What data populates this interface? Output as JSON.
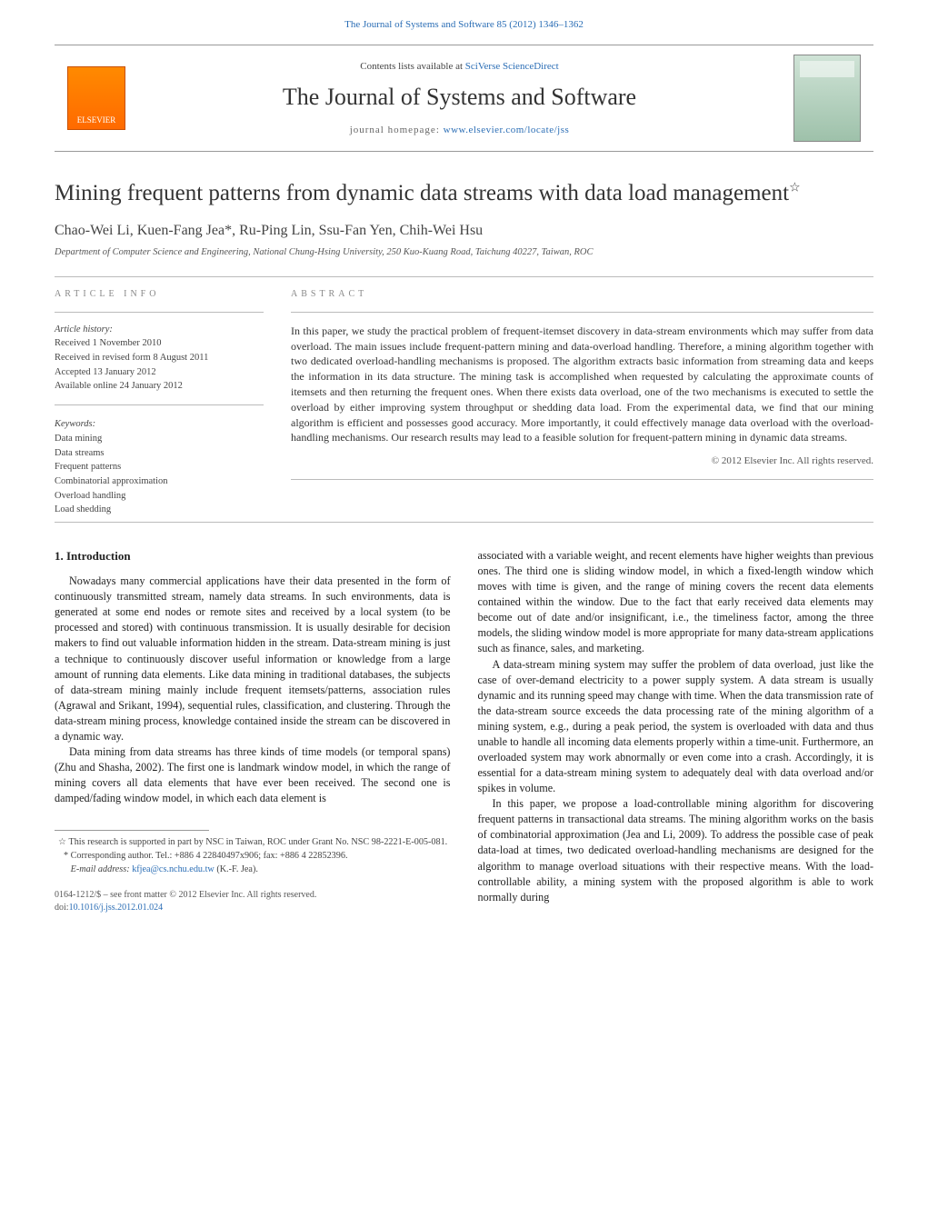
{
  "header": {
    "citation": "The Journal of Systems and Software 85 (2012) 1346–1362",
    "contents_prefix": "Contents lists available at ",
    "contents_link": "SciVerse ScienceDirect",
    "journal_name": "The Journal of Systems and Software",
    "homepage_prefix": "journal homepage: ",
    "homepage_url": "www.elsevier.com/locate/jss",
    "publisher_logo": "ELSEVIER"
  },
  "article": {
    "title": "Mining frequent patterns from dynamic data streams with data load management",
    "title_marker": "☆",
    "authors": "Chao-Wei Li, Kuen-Fang Jea*, Ru-Ping Lin, Ssu-Fan Yen, Chih-Wei Hsu",
    "affiliation": "Department of Computer Science and Engineering, National Chung-Hsing University, 250 Kuo-Kuang Road, Taichung 40227, Taiwan, ROC"
  },
  "article_info": {
    "heading": "ARTICLE INFO",
    "history_label": "Article history:",
    "received": "Received 1 November 2010",
    "revised": "Received in revised form 8 August 2011",
    "accepted": "Accepted 13 January 2012",
    "online": "Available online 24 January 2012",
    "keywords_label": "Keywords:",
    "keywords": [
      "Data mining",
      "Data streams",
      "Frequent patterns",
      "Combinatorial approximation",
      "Overload handling",
      "Load shedding"
    ]
  },
  "abstract": {
    "heading": "ABSTRACT",
    "text": "In this paper, we study the practical problem of frequent-itemset discovery in data-stream environments which may suffer from data overload. The main issues include frequent-pattern mining and data-overload handling. Therefore, a mining algorithm together with two dedicated overload-handling mechanisms is proposed. The algorithm extracts basic information from streaming data and keeps the information in its data structure. The mining task is accomplished when requested by calculating the approximate counts of itemsets and then returning the frequent ones. When there exists data overload, one of the two mechanisms is executed to settle the overload by either improving system throughput or shedding data load. From the experimental data, we find that our mining algorithm is efficient and possesses good accuracy. More importantly, it could effectively manage data overload with the overload-handling mechanisms. Our research results may lead to a feasible solution for frequent-pattern mining in dynamic data streams.",
    "copyright": "© 2012 Elsevier Inc. All rights reserved."
  },
  "body": {
    "section_number": "1.",
    "section_title": "Introduction",
    "col1_p1": "Nowadays many commercial applications have their data presented in the form of continuously transmitted stream, namely data streams. In such environments, data is generated at some end nodes or remote sites and received by a local system (to be processed and stored) with continuous transmission. It is usually desirable for decision makers to find out valuable information hidden in the stream. Data-stream mining is just a technique to continuously discover useful information or knowledge from a large amount of running data elements. Like data mining in traditional databases, the subjects of data-stream mining mainly include frequent itemsets/patterns, association rules (Agrawal and Srikant, 1994), sequential rules, classification, and clustering. Through the data-stream mining process, knowledge contained inside the stream can be discovered in a dynamic way.",
    "col1_p2": "Data mining from data streams has three kinds of time models (or temporal spans) (Zhu and Shasha, 2002). The first one is landmark window model, in which the range of mining covers all data elements that have ever been received. The second one is damped/fading window model, in which each data element is",
    "col2_p1": "associated with a variable weight, and recent elements have higher weights than previous ones. The third one is sliding window model, in which a fixed-length window which moves with time is given, and the range of mining covers the recent data elements contained within the window. Due to the fact that early received data elements may become out of date and/or insignificant, i.e., the timeliness factor, among the three models, the sliding window model is more appropriate for many data-stream applications such as finance, sales, and marketing.",
    "col2_p2": "A data-stream mining system may suffer the problem of data overload, just like the case of over-demand electricity to a power supply system. A data stream is usually dynamic and its running speed may change with time. When the data transmission rate of the data-stream source exceeds the data processing rate of the mining algorithm of a mining system, e.g., during a peak period, the system is overloaded with data and thus unable to handle all incoming data elements properly within a time-unit. Furthermore, an overloaded system may work abnormally or even come into a crash. Accordingly, it is essential for a data-stream mining system to adequately deal with data overload and/or spikes in volume.",
    "col2_p3": "In this paper, we propose a load-controllable mining algorithm for discovering frequent patterns in transactional data streams. The mining algorithm works on the basis of combinatorial approximation (Jea and Li, 2009). To address the possible case of peak data-load at times, two dedicated overload-handling mechanisms are designed for the algorithm to manage overload situations with their respective means. With the load-controllable ability, a mining system with the proposed algorithm is able to work normally during"
  },
  "footnotes": {
    "funding": "☆ This research is supported in part by NSC in Taiwan, ROC under Grant No. NSC 98-2221-E-005-081.",
    "corresponding": "* Corresponding author. Tel.: +886 4 22840497x906; fax: +886 4 22852396.",
    "email_label": "E-mail address:",
    "email": "kfjea@cs.nchu.edu.tw",
    "email_suffix": "(K.-F. Jea)."
  },
  "doi": {
    "front_matter": "0164-1212/$ – see front matter © 2012 Elsevier Inc. All rights reserved.",
    "doi_label": "doi:",
    "doi_value": "10.1016/j.jss.2012.01.024"
  }
}
